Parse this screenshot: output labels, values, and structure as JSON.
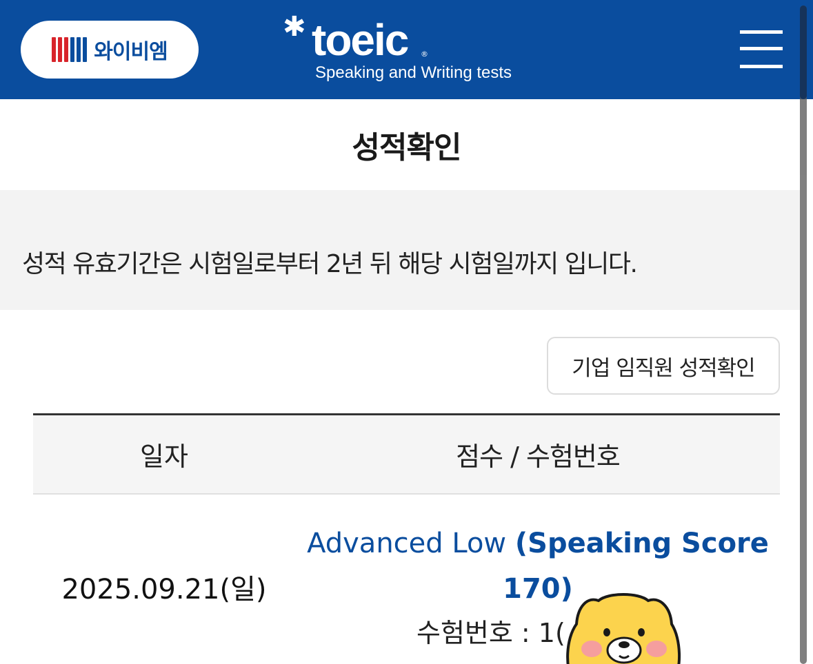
{
  "header": {
    "ybm_logo_text": "와이비엠",
    "toeic_wordmark": "toeic",
    "toeic_registered": "®",
    "toeic_subtitle": "Speaking and Writing tests",
    "menu_icon": "hamburger-menu-icon",
    "background_color": "#0a4d9e"
  },
  "page": {
    "title": "성적확인"
  },
  "notice": {
    "text": "성적 유효기간은 시험일로부터 2년 뒤 해당 시험일까지 입니다."
  },
  "actions": {
    "corporate_check_label": "기업 임직원 성적확인"
  },
  "table": {
    "headers": [
      "일자",
      "점수 / 수험번호"
    ],
    "rows": [
      {
        "date": "2025.09.21(일)",
        "level": "Advanced Low",
        "score_detail": "(Speaking Score 170)",
        "exam_no": "수험번호 : 1("
      }
    ]
  },
  "colors": {
    "brand_blue": "#0a4d9e",
    "ybm_red": "#d8242b",
    "notice_bg": "#f3f3f3"
  }
}
